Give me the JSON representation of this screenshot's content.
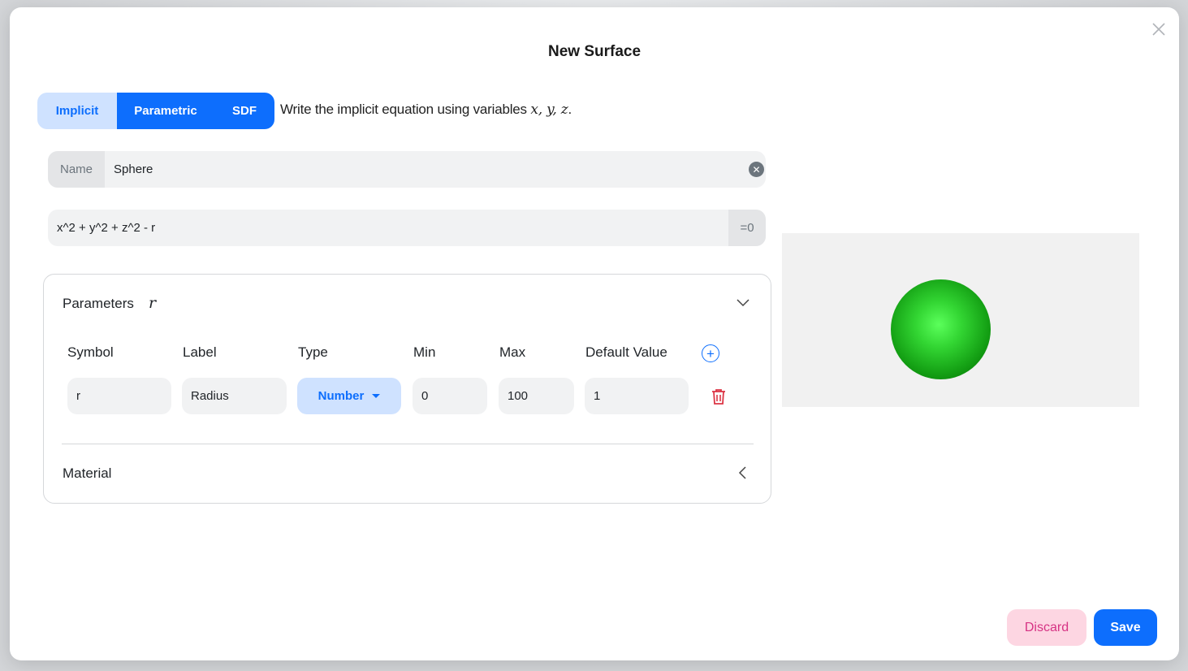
{
  "dialog": {
    "title": "New Surface",
    "close_icon": "close-icon"
  },
  "mode_tabs": {
    "implicit": "Implicit",
    "parametric": "Parametric",
    "sdf": "SDF",
    "active": "Implicit"
  },
  "hint": {
    "text": "Write the implicit equation using variables",
    "variables": "x, y, z",
    "suffix": "."
  },
  "name_field": {
    "label": "Name",
    "value": "Sphere",
    "clear_icon": "clear-icon"
  },
  "equation_field": {
    "value": "x^2 + y^2 + z^2 - r",
    "suffix": "=0"
  },
  "parameters": {
    "header": "Parameters",
    "symbols_summary": "r",
    "expanded": true,
    "columns": {
      "symbol": "Symbol",
      "label": "Label",
      "type": "Type",
      "min": "Min",
      "max": "Max",
      "default": "Default Value"
    },
    "rows": [
      {
        "symbol": "r",
        "label": "Radius",
        "type": "Number",
        "min": "0",
        "max": "100",
        "default": "1"
      }
    ]
  },
  "material": {
    "header": "Material",
    "expanded": false
  },
  "preview": {
    "background": "#f1f1f1",
    "object_color": "#22bb22"
  },
  "footer": {
    "discard": "Discard",
    "save": "Save"
  },
  "colors": {
    "primary": "#0d6efd",
    "primary_light": "#cfe2ff",
    "danger": "#dc3545",
    "discard_bg": "#fdd6e2",
    "discard_text": "#d63384"
  }
}
